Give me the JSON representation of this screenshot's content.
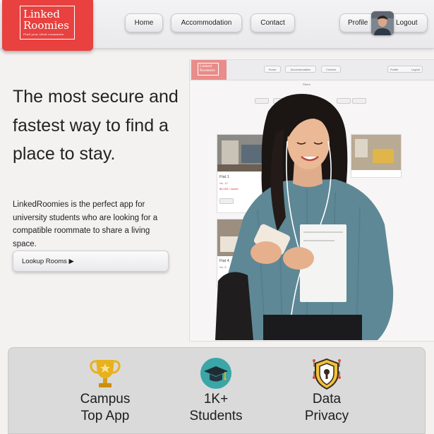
{
  "brand": {
    "line1": "Linked",
    "line2": "Roomies",
    "tagline": "Find your ideal roommate"
  },
  "nav": {
    "home": "Home",
    "accommodation": "Accommodation",
    "contact": "Contact",
    "profile": "Profile",
    "logout": "Logout"
  },
  "hero": {
    "title": "The most secure and fastest way to find a place to stay.",
    "description": "LinkedRoomies is the perfect app for university students who are looking for a compatible roommate to share a living space.",
    "cta": "Lookup Rooms ▶"
  },
  "mock": {
    "brand_line1": "Linked",
    "brand_line2": "Roomies",
    "nav": [
      "Home",
      "Accommodation",
      "Contact"
    ],
    "profile": "Profile",
    "logout": "Logout",
    "filter_title": "Filters",
    "cards": [
      {
        "title": "Flat 1",
        "sub": "No. 12",
        "price": "$4,000 / month"
      },
      {
        "title": "Flat 4",
        "sub": "No. 8"
      }
    ]
  },
  "features": [
    {
      "icon": "trophy-icon",
      "line1": "Campus",
      "line2": "Top App"
    },
    {
      "icon": "graduation-cap-icon",
      "line1": "1K+",
      "line2": "Students"
    },
    {
      "icon": "data-privacy-icon",
      "line1": "Data",
      "line2": "Privacy"
    }
  ],
  "colors": {
    "brand_red": "#e8413f",
    "feature_bg": "#dadada",
    "page_bg": "#f4f1f1",
    "cap_circle": "#3aa6a7",
    "trophy_gold": "#e8b21d"
  }
}
